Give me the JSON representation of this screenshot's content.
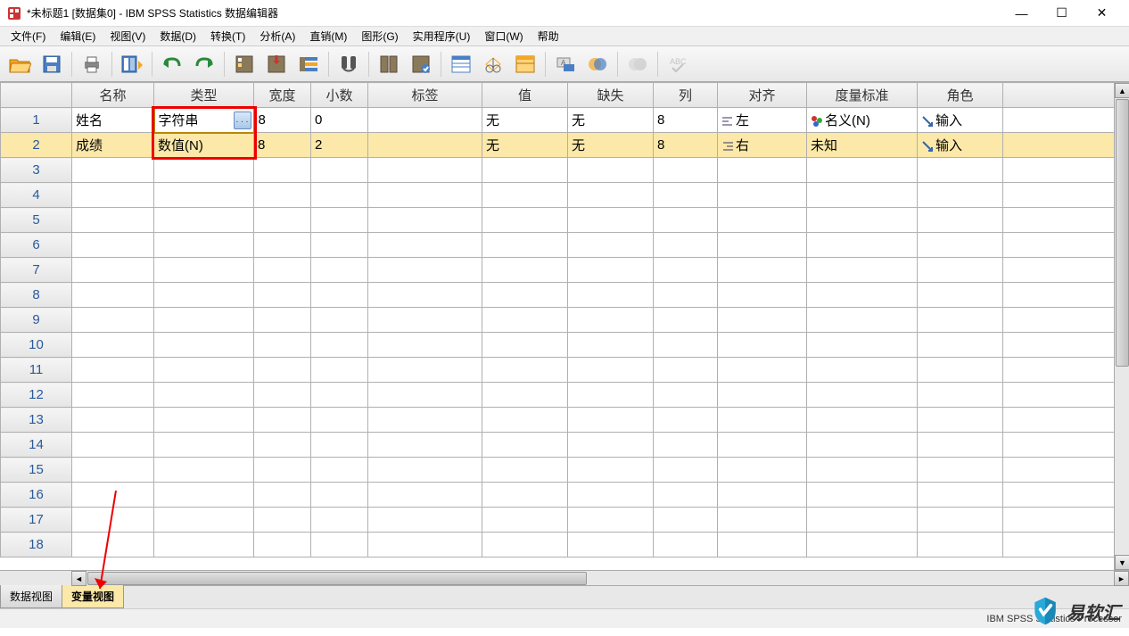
{
  "window": {
    "title": "*未标题1 [数据集0] - IBM SPSS Statistics 数据编辑器",
    "min": "—",
    "max": "☐",
    "close": "✕"
  },
  "menu": {
    "file": "文件(F)",
    "edit": "编辑(E)",
    "view": "视图(V)",
    "data": "数据(D)",
    "transform": "转换(T)",
    "analyze": "分析(A)",
    "direct": "直销(M)",
    "graphs": "图形(G)",
    "util": "实用程序(U)",
    "window": "窗口(W)",
    "help": "帮助"
  },
  "columns": {
    "name": "名称",
    "type": "类型",
    "width": "宽度",
    "decimals": "小数",
    "label": "标签",
    "values": "值",
    "missing": "缺失",
    "cols": "列",
    "align": "对齐",
    "measure": "度量标准",
    "role": "角色"
  },
  "rows": [
    {
      "n": "1",
      "name": "姓名",
      "type": "字符串",
      "width": "8",
      "decimals": "0",
      "label": "",
      "values": "无",
      "missing": "无",
      "cols": "8",
      "align": "左",
      "measure": "名义(N)",
      "role": "输入"
    },
    {
      "n": "2",
      "name": "成绩",
      "type": "数值(N)",
      "width": "8",
      "decimals": "2",
      "label": "",
      "values": "无",
      "missing": "无",
      "cols": "8",
      "align": "右",
      "measure": "未知",
      "role": "输入"
    }
  ],
  "emptyrows": [
    "3",
    "4",
    "5",
    "6",
    "7",
    "8",
    "9",
    "10",
    "11",
    "12",
    "13",
    "14",
    "15",
    "16",
    "17",
    "18"
  ],
  "dots": ". . .",
  "tabs": {
    "data": "数据视图",
    "var": "变量视图"
  },
  "status": "IBM SPSS Statistics Processor",
  "watermark": "易软汇"
}
